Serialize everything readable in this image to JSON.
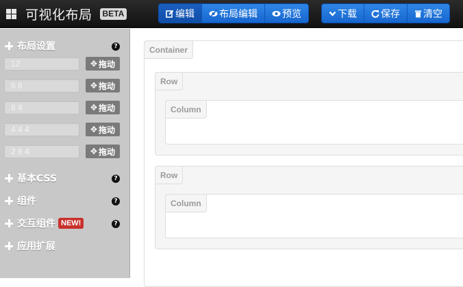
{
  "brand": {
    "title": "可视化布局",
    "badge": "BETA"
  },
  "toolbar": {
    "mode_buttons": [
      {
        "label": "编辑",
        "icon": "edit-icon",
        "active": true
      },
      {
        "label": "布局编辑",
        "icon": "eye-slash-icon",
        "active": false
      },
      {
        "label": "预览",
        "icon": "eye-icon",
        "active": false
      }
    ],
    "action_buttons": [
      {
        "label": "下载",
        "icon": "chevron-down-icon"
      },
      {
        "label": "保存",
        "icon": "share-icon"
      },
      {
        "label": "清空",
        "icon": "trash-icon"
      }
    ],
    "accent_color": "#1f74dc"
  },
  "sidebar": {
    "sections": [
      {
        "label": "布局设置",
        "help": "?"
      },
      {
        "label": "基本CSS",
        "help": "?"
      },
      {
        "label": "组件",
        "help": "?"
      },
      {
        "label": "交互组件",
        "help": "?",
        "badge": "NEW!"
      },
      {
        "label": "应用扩展"
      }
    ],
    "layouts": [
      {
        "value": "12",
        "drag_label": "拖动"
      },
      {
        "value": "6 6",
        "drag_label": "拖动"
      },
      {
        "value": "8 4",
        "drag_label": "拖动"
      },
      {
        "value": "4 4 4",
        "drag_label": "拖动"
      },
      {
        "value": "2 6 4",
        "drag_label": "拖动"
      }
    ]
  },
  "canvas": {
    "container_label": "Container",
    "rows": [
      {
        "label": "Row",
        "column_label": "Column"
      },
      {
        "label": "Row",
        "column_label": "Column"
      }
    ]
  }
}
